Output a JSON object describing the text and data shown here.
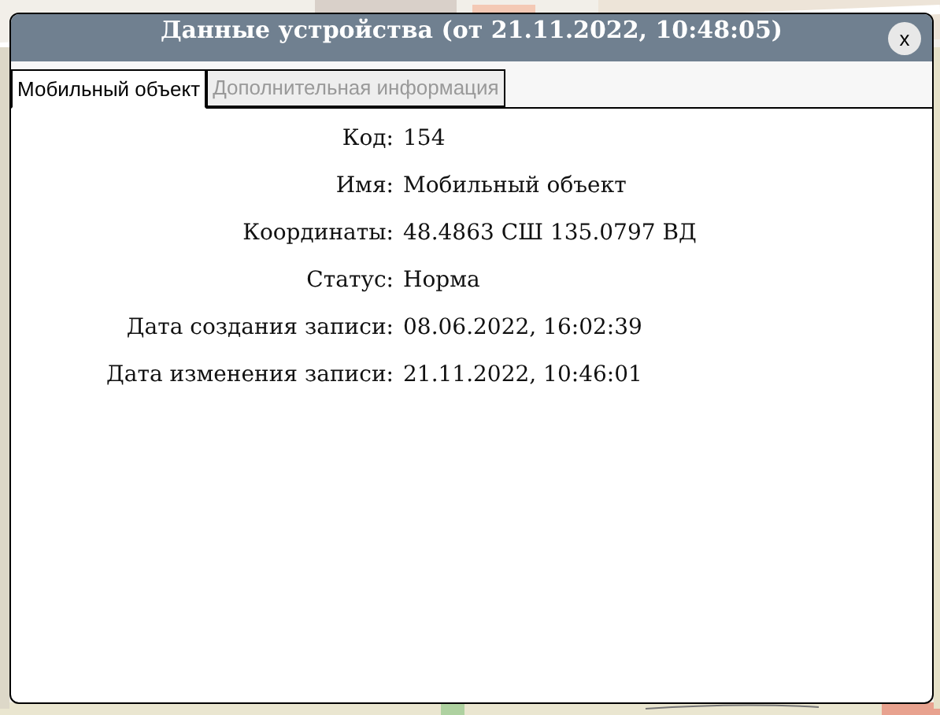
{
  "window": {
    "title": "Данные устройства (от 21.11.2022, 10:48:05)",
    "close": "x"
  },
  "tabs": [
    {
      "label": "Мобильный объект",
      "selected": true
    },
    {
      "label": "Дополнительная информация",
      "selected": false
    }
  ],
  "fields": [
    {
      "label": "Код:",
      "value": "154"
    },
    {
      "label": "Имя:",
      "value": "Мобильный объект"
    },
    {
      "label": "Координаты:",
      "value": "48.4863 СШ 135.0797 ВД"
    },
    {
      "label": "Статус:",
      "value": "Норма"
    },
    {
      "label": "Дата создания записи:",
      "value": "08.06.2022, 16:02:39"
    },
    {
      "label": "Дата изменения записи:",
      "value": "21.11.2022, 10:46:01"
    }
  ]
}
